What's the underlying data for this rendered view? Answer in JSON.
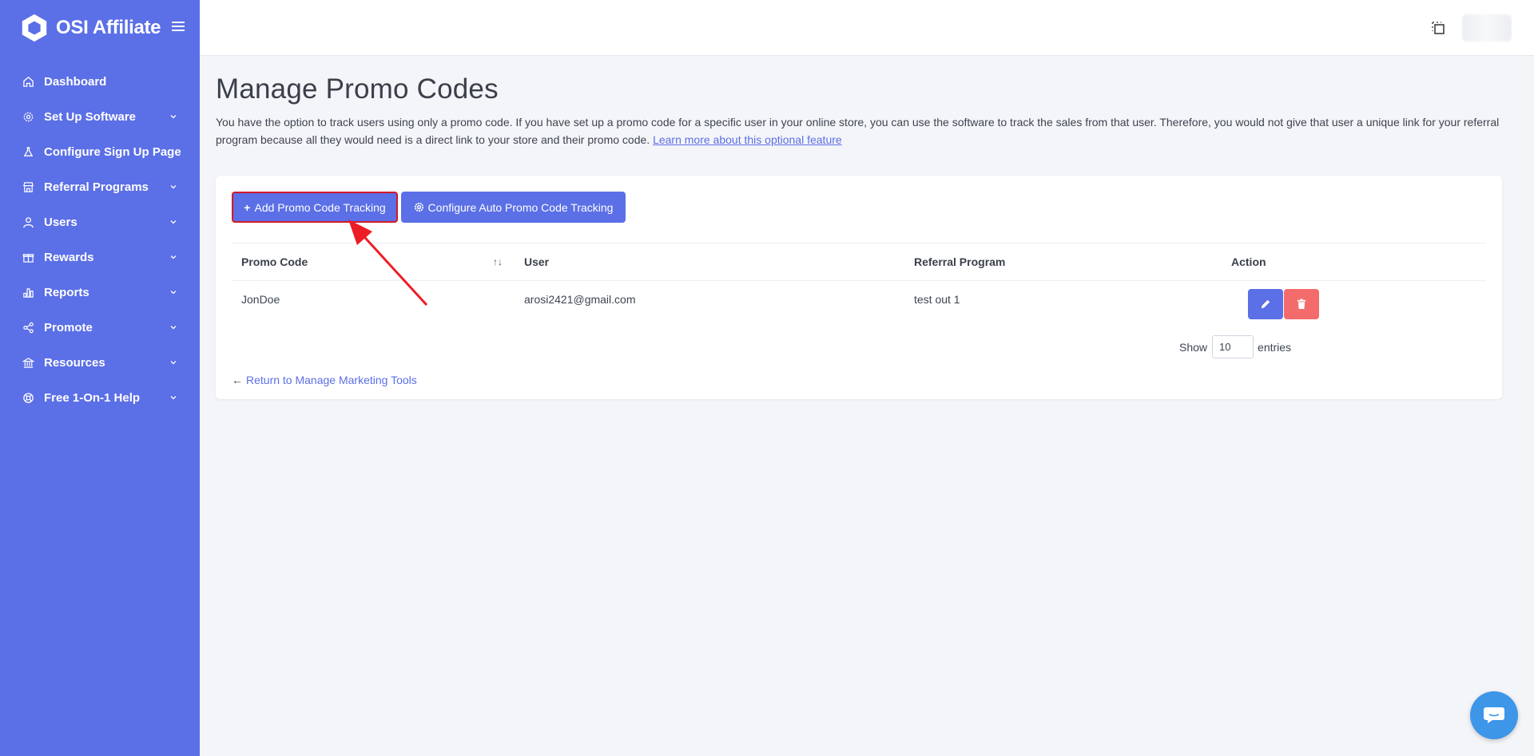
{
  "brand": {
    "name": "OSI Affiliate"
  },
  "sidebar": {
    "items": [
      {
        "label": "Dashboard",
        "icon": "home-icon",
        "has_children": false
      },
      {
        "label": "Set Up Software",
        "icon": "gear-icon",
        "has_children": true
      },
      {
        "label": "Configure Sign Up Page",
        "icon": "flask-icon",
        "has_children": false
      },
      {
        "label": "Referral Programs",
        "icon": "store-icon",
        "has_children": true
      },
      {
        "label": "Users",
        "icon": "user-icon",
        "has_children": true
      },
      {
        "label": "Rewards",
        "icon": "gift-icon",
        "has_children": true
      },
      {
        "label": "Reports",
        "icon": "bar-chart-icon",
        "has_children": true
      },
      {
        "label": "Promote",
        "icon": "share-icon",
        "has_children": true
      },
      {
        "label": "Resources",
        "icon": "bank-icon",
        "has_children": true
      },
      {
        "label": "Free 1-On-1 Help",
        "icon": "lifebuoy-icon",
        "has_children": true
      }
    ]
  },
  "page": {
    "title": "Manage Promo Codes",
    "description": "You have the option to track users using only a promo code. If you have set up a promo code for a specific user in your online store, you can use the software to track the sales from that user. Therefore, you would not give that user a unique link for your referral program because all they would need is a direct link to your store and their promo code.",
    "learn_more": "Learn more about this optional feature"
  },
  "toolbar": {
    "add_label": "Add Promo Code Tracking",
    "config_label": "Configure Auto Promo Code Tracking"
  },
  "table": {
    "headers": {
      "promo_code": "Promo Code",
      "user": "User",
      "program": "Referral Program",
      "action": "Action"
    },
    "rows": [
      {
        "promo_code": "JonDoe",
        "user": "arosi2421@gmail.com",
        "program": "test out 1"
      }
    ]
  },
  "pagination": {
    "show_label": "Show",
    "entries_value": "10",
    "entries_label": "entries"
  },
  "footer_link": {
    "return_label": "Return to Manage Marketing Tools"
  },
  "colors": {
    "primary": "#5b6fe6",
    "danger": "#f46b6b",
    "highlight": "#d11a2a",
    "chat": "#3d96e8"
  }
}
